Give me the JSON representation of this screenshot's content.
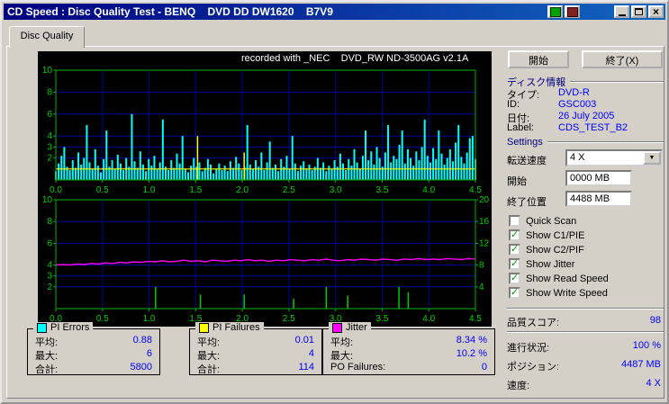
{
  "window": {
    "title": "CD Speed : Disc Quality Test - BENQ    DVD DD DW1620    B7V9"
  },
  "tab": {
    "label": "Disc Quality"
  },
  "chart_header": "recorded with _NEC    DVD_RW ND-3500AG v2.1A",
  "colors": {
    "accent_value_text": "#0000ff",
    "chart_background": "#000000",
    "chart_grid": "#0000a0",
    "chart_axis": "#00b400",
    "chart_labels": "#00d400",
    "pi_errors": "#00ffff",
    "pi_failures": "#ffff00",
    "jitter": "#ff00ff",
    "write_speed": "#00cc00"
  },
  "chart_data": [
    {
      "type": "area",
      "title": "PI Errors / PI Failures scan",
      "xlabel": "GB",
      "x_range": [
        0,
        4.5
      ],
      "x_ticks": [
        "0.0",
        "0.5",
        "1.0",
        "1.5",
        "2.0",
        "2.5",
        "3.0",
        "3.5",
        "4.0",
        "4.5"
      ],
      "ylim": [
        0,
        10
      ],
      "y_ticks": [
        2,
        3,
        4,
        6,
        8,
        10
      ],
      "grid": true,
      "series": [
        {
          "name": "PI Errors",
          "color": "#00ffff",
          "style": "spikefill",
          "values": [
            0.8,
            1.5,
            2.2,
            3.0,
            1.2,
            0.9,
            1.8,
            1.1,
            2.5,
            1.4,
            2.0,
            5.0,
            1.6,
            1.0,
            2.8,
            1.3,
            0.7,
            1.9,
            4.5,
            1.2,
            1.8,
            1.0,
            2.3,
            1.5,
            0.9,
            2.0,
            1.2,
            6.0,
            1.7,
            1.1,
            2.6,
            1.4,
            0.8,
            1.9,
            1.3,
            2.2,
            1.0,
            1.6,
            5.5,
            1.2,
            0.9,
            1.8,
            1.1,
            2.4,
            1.5,
            4.0,
            1.0,
            0.7,
            1.3,
            2.0,
            1.2,
            1.6,
            0.8,
            1.1,
            1.9,
            1.4,
            0.6,
            1.0,
            1.5,
            0.9,
            1.3,
            0.8,
            1.7,
            1.1,
            2.1,
            1.5,
            0.9,
            1.2,
            5.0,
            1.4,
            1.0,
            1.8,
            1.2,
            2.5,
            0.9,
            1.6,
            3.5,
            1.1,
            1.4,
            0.8,
            1.9,
            1.2,
            2.2,
            1.0,
            4.0,
            1.5,
            0.8,
            1.3,
            1.7,
            1.0,
            1.4,
            0.9,
            1.2,
            2.0,
            1.1,
            1.6,
            0.8,
            1.3,
            1.0,
            1.8,
            1.2,
            2.4,
            1.5,
            0.9,
            1.9,
            1.3,
            2.8,
            1.6,
            1.0,
            2.2,
            4.5,
            1.8,
            2.6,
            1.4,
            3.0,
            2.0,
            1.2,
            2.5,
            5.0,
            1.6,
            2.2,
            1.9,
            3.2,
            4.5,
            1.5,
            2.8,
            2.0,
            1.3,
            2.6,
            1.8,
            3.0,
            5.5,
            2.2,
            1.6,
            2.9,
            1.9,
            4.5,
            2.4,
            1.4,
            2.0,
            2.8,
            1.7,
            3.4,
            5.0,
            2.1,
            1.5,
            2.5,
            3.8,
            4.0,
            1.9
          ]
        },
        {
          "name": "PI Failures",
          "color": "#ffff00",
          "style": "baseline-spikes",
          "baseline": 1.0,
          "spikes": [
            {
              "x": 1.52,
              "v": 4.0
            },
            {
              "x": 2.02,
              "v": 2.5
            }
          ]
        }
      ]
    },
    {
      "type": "line",
      "title": "Jitter / Write Speed scan",
      "xlabel": "GB",
      "x_range": [
        0,
        4.5
      ],
      "x_ticks": [
        "0.0",
        "0.5",
        "1.0",
        "1.5",
        "2.0",
        "2.5",
        "3.0",
        "3.5",
        "4.0",
        "4.5"
      ],
      "ylim_left": [
        0,
        10
      ],
      "y_ticks_left": [
        2,
        3,
        4,
        6,
        8,
        10
      ],
      "ylim_right": [
        0,
        20
      ],
      "y_ticks_right": [
        4,
        8,
        12,
        16,
        20
      ],
      "grid": true,
      "series": [
        {
          "name": "Jitter",
          "color": "#ff00ff",
          "axis": "right",
          "style": "line",
          "values": [
            8.0,
            8.1,
            8.0,
            8.2,
            8.1,
            8.3,
            8.2,
            8.4,
            8.3,
            8.5,
            8.4,
            8.6,
            8.5,
            8.7,
            8.6,
            8.8,
            8.6,
            8.7,
            8.9,
            8.7,
            8.8,
            8.6,
            8.9,
            8.8,
            8.7,
            8.9,
            8.8,
            9.0,
            8.8,
            8.9,
            8.7,
            8.9,
            8.8,
            9.0,
            8.9,
            8.8,
            9.0,
            8.9,
            9.1,
            8.9,
            8.8,
            9.0,
            8.9,
            9.1,
            9.0,
            8.9,
            9.1,
            9.0,
            8.9,
            9.1,
            9.0,
            9.2,
            9.0,
            9.1,
            9.0,
            9.2,
            9.1,
            9.0,
            9.2,
            9.1
          ]
        },
        {
          "name": "Write Speed",
          "color": "#00cc00",
          "axis": "right",
          "style": "spikes",
          "spikes": [
            {
              "x": 1.07,
              "v": 4.0
            },
            {
              "x": 1.55,
              "v": 2.6
            },
            {
              "x": 2.02,
              "v": 2.6
            },
            {
              "x": 2.55,
              "v": 1.8
            },
            {
              "x": 2.9,
              "v": 4.0
            },
            {
              "x": 3.13,
              "v": 2.4
            },
            {
              "x": 3.68,
              "v": 4.0
            },
            {
              "x": 3.78,
              "v": 3.0
            }
          ]
        }
      ]
    }
  ],
  "legend": {
    "boxes": [
      {
        "title": "PI Errors",
        "color": "#00ffff",
        "rows": [
          {
            "label": "平均:",
            "value": "0.88"
          },
          {
            "label": "最大:",
            "value": "6"
          },
          {
            "label": "合計:",
            "value": "5800"
          }
        ]
      },
      {
        "title": "PI Failures",
        "color": "#ffff00",
        "rows": [
          {
            "label": "平均:",
            "value": "0.01"
          },
          {
            "label": "最大:",
            "value": "4"
          },
          {
            "label": "合計:",
            "value": "114"
          }
        ]
      },
      {
        "title": "Jitter",
        "color": "#ff00ff",
        "rows": [
          {
            "label": "平均:",
            "value": "8.34 %"
          },
          {
            "label": "最大:",
            "value": "10.2 %"
          },
          {
            "label": "PO Failures:",
            "value": "0"
          }
        ]
      }
    ]
  },
  "panel": {
    "start_button": "開始",
    "exit_button": "終了(X)",
    "disc_info": {
      "header": "ディスク情報",
      "rows": [
        {
          "label": "タイプ:",
          "value": "DVD-R"
        },
        {
          "label": "ID:",
          "value": "GSC003"
        },
        {
          "label": "日付:",
          "value": "26 July 2005"
        },
        {
          "label": "Label:",
          "value": "CDS_TEST_B2"
        }
      ]
    },
    "settings_header": "Settings",
    "speed_label": "転送速度",
    "speed_value": "4 X",
    "start_label": "開始",
    "start_value": "0000 MB",
    "end_label": "終了位置",
    "end_value": "4488 MB",
    "checkboxes": [
      {
        "label": "Quick Scan",
        "checked": false
      },
      {
        "label": "Show C1/PIE",
        "checked": true
      },
      {
        "label": "Show C2/PIF",
        "checked": true
      },
      {
        "label": "Show Jitter",
        "checked": true
      },
      {
        "label": "Show Read Speed",
        "checked": true
      },
      {
        "label": "Show Write Speed",
        "checked": true
      }
    ],
    "score_label": "品質スコア:",
    "score_value": "98",
    "status_rows": [
      {
        "label": "進行状況:",
        "value": "100 %"
      },
      {
        "label": "ポジション:",
        "value": "4487 MB"
      },
      {
        "label": "速度:",
        "value": "4 X"
      }
    ]
  }
}
